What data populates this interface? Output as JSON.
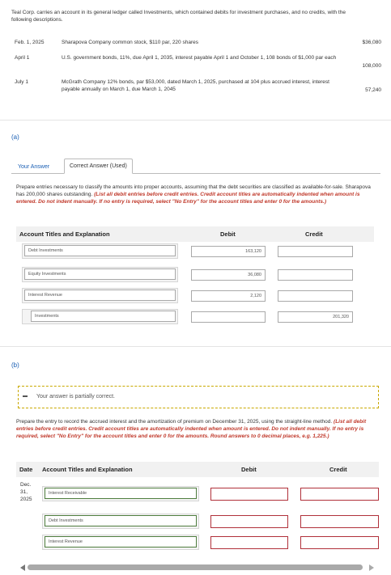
{
  "intro": {
    "text": "Teal Corp. carries an account in its general ledger called Investments, which contained debits for investment purchases, and no credits, with the following descriptions.",
    "rows": [
      {
        "date": "Feb. 1, 2025",
        "desc": "Sharapova Company common stock, $110 par, 220 shares",
        "amount": "$36,080"
      },
      {
        "date": "April 1",
        "desc": "U.S. government bonds, 11%, due April 1, 2035, interest payable April 1 and October 1, 108 bonds of $1,000 par each",
        "amount": "108,000"
      },
      {
        "date": "July 1",
        "desc": "McGrath Company 12% bonds, par $53,000, dated March 1, 2025, purchased at 104 plus accrued interest, interest payable annually on March 1, due March 1, 2045",
        "amount": "57,240"
      }
    ]
  },
  "part_a": {
    "label": "(a)",
    "tabs": [
      "Your Answer",
      "Correct Answer (Used)"
    ],
    "instructions_plain": "Prepare entries necessary to classify the amounts into proper accounts, assuming that the debt securities are classified as available-for-sale. Sharapova has 200,000 shares outstanding.",
    "instructions_red": "(List all debit entries before credit entries. Credit account titles are automatically indented when amount is entered. Do not indent manually. If no entry is required, select \"No Entry\" for the account titles and enter 0 for the amounts.)",
    "headers": {
      "account": "Account Titles and Explanation",
      "debit": "Debit",
      "credit": "Credit"
    },
    "rows": [
      {
        "account": "Debt Investments",
        "debit": "163,120",
        "credit": ""
      },
      {
        "account": "Equity Investments",
        "debit": "36,080",
        "credit": ""
      },
      {
        "account": "Interest Revenue",
        "debit": "2,120",
        "credit": ""
      },
      {
        "account": "Investments",
        "debit": "",
        "credit": "201,320"
      }
    ]
  },
  "part_b": {
    "label": "(b)",
    "status": "Your answer is partially correct.",
    "instructions_plain": "Prepare the entry to record the accrued interest and the amortization of premium on December 31, 2025, using the straight-line method.",
    "instructions_red": "(List all debit entries before credit entries. Credit account titles are automatically indented when amount is entered. Do not indent manually. If no entry is required, select \"No Entry\" for the account titles and enter 0 for the amounts. Round answers to 0 decimal places, e.g. 1,225.)",
    "headers": {
      "date": "Date",
      "account": "Account Titles and Explanation",
      "debit": "Debit",
      "credit": "Credit"
    },
    "date": [
      "Dec.",
      "31,",
      "2025"
    ],
    "rows": [
      {
        "account": "Interest Receivable",
        "debit": "",
        "credit": ""
      },
      {
        "account": "Debt Investments",
        "debit": "",
        "credit": ""
      },
      {
        "account": "Interest Revenue",
        "debit": "",
        "credit": ""
      }
    ]
  },
  "colors": {
    "link": "#1a5fb4",
    "correct": "#4e7d3e",
    "incorrect": "#b0303a",
    "warning": "#c9a900"
  }
}
